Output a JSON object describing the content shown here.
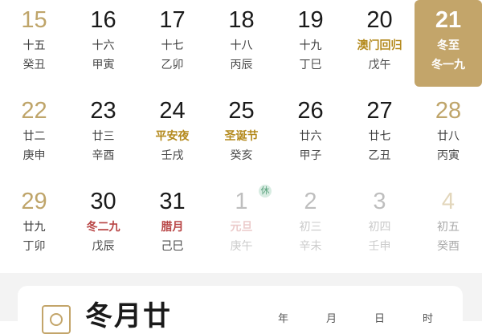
{
  "calendar": {
    "rows": [
      [
        {
          "day": "15",
          "lunar": "十五",
          "ganzhi": "癸丑",
          "type": "weekend"
        },
        {
          "day": "16",
          "lunar": "十六",
          "ganzhi": "甲寅",
          "type": "normal"
        },
        {
          "day": "17",
          "lunar": "十七",
          "ganzhi": "乙卯",
          "type": "normal"
        },
        {
          "day": "18",
          "lunar": "十八",
          "ganzhi": "丙辰",
          "type": "normal"
        },
        {
          "day": "19",
          "lunar": "十九",
          "ganzhi": "丁巳",
          "type": "normal"
        },
        {
          "day": "20",
          "lunar": "澳门回归",
          "ganzhi": "戊午",
          "type": "normal",
          "lunar_style": "festival"
        },
        {
          "day": "21",
          "lunar": "冬至",
          "ganzhi": "冬一九",
          "type": "selected"
        }
      ],
      [
        {
          "day": "22",
          "lunar": "廿二",
          "ganzhi": "庚申",
          "type": "weekend"
        },
        {
          "day": "23",
          "lunar": "廿三",
          "ganzhi": "辛酉",
          "type": "normal"
        },
        {
          "day": "24",
          "lunar": "平安夜",
          "ganzhi": "壬戌",
          "type": "normal",
          "lunar_style": "festival"
        },
        {
          "day": "25",
          "lunar": "圣诞节",
          "ganzhi": "癸亥",
          "type": "normal",
          "lunar_style": "festival"
        },
        {
          "day": "26",
          "lunar": "廿六",
          "ganzhi": "甲子",
          "type": "normal"
        },
        {
          "day": "27",
          "lunar": "廿七",
          "ganzhi": "乙丑",
          "type": "normal"
        },
        {
          "day": "28",
          "lunar": "廿八",
          "ganzhi": "丙寅",
          "type": "weekend"
        }
      ],
      [
        {
          "day": "29",
          "lunar": "廿九",
          "ganzhi": "丁卯",
          "type": "weekend"
        },
        {
          "day": "30",
          "lunar": "冬二九",
          "ganzhi": "戊辰",
          "type": "normal",
          "lunar_style": "red"
        },
        {
          "day": "31",
          "lunar": "腊月",
          "ganzhi": "己巳",
          "type": "normal",
          "lunar_style": "red"
        },
        {
          "day": "1",
          "lunar": "元旦",
          "ganzhi": "庚午",
          "type": "other",
          "lunar_style": "red",
          "badge": "休"
        },
        {
          "day": "2",
          "lunar": "初三",
          "ganzhi": "辛未",
          "type": "other"
        },
        {
          "day": "3",
          "lunar": "初四",
          "ganzhi": "壬申",
          "type": "other"
        },
        {
          "day": "4",
          "lunar": "初五",
          "ganzhi": "癸酉",
          "type": "other-weekend"
        }
      ]
    ]
  },
  "solar_term": {
    "title": "冬月廿",
    "labels": [
      "年",
      "月",
      "日",
      "时"
    ]
  },
  "colors": {
    "accent_gold": "#c3a56a",
    "festival_gold": "#b48a1e",
    "festival_red": "#b84545"
  }
}
